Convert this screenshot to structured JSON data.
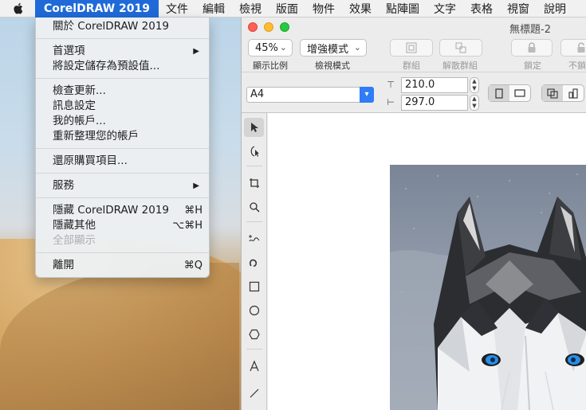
{
  "menubar": {
    "app_menu": "CorelDRAW 2019",
    "items": [
      "文件",
      "編輯",
      "檢視",
      "版面",
      "物件",
      "效果",
      "點陣圖",
      "文字",
      "表格",
      "視窗",
      "說明"
    ]
  },
  "app_menu": {
    "about": "關於 CorelDRAW 2019",
    "preferences": "首選項",
    "save_defaults": "將設定儲存為預設值...",
    "check_updates": "檢查更新...",
    "message_settings": "訊息設定",
    "my_account": "我的帳戶...",
    "refresh_account": "重新整理您的帳戶",
    "restore_purchases": "還原購買項目...",
    "services": "服務",
    "hide_app": "隱藏 CorelDRAW 2019",
    "hide_app_shortcut": "⌘H",
    "hide_others": "隱藏其他",
    "hide_others_shortcut": "⌥⌘H",
    "show_all": "全部顯示",
    "quit": "離開",
    "quit_shortcut": "⌘Q"
  },
  "window": {
    "title": "無標題-2",
    "zoom_value": "45%",
    "zoom_label": "顯示比例",
    "view_mode_value": "增強模式",
    "view_mode_label": "檢視模式",
    "group_label": "群組",
    "ungroup_label": "解散群組",
    "lock_label": "鎖定",
    "unlock_label": "不鎖"
  },
  "propbar": {
    "page_size": "A4",
    "width": "210.0",
    "height": "297.0"
  }
}
